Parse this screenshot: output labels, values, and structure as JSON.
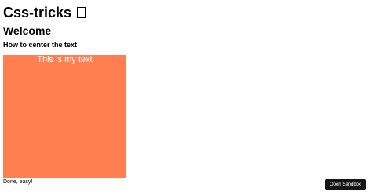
{
  "page": {
    "title": "Css-tricks",
    "subtitle": "Welcome",
    "heading": "How to center the text"
  },
  "demo": {
    "text": "This is my text",
    "box_color": "#ff7f50"
  },
  "footer": {
    "text": "Done, easy!"
  },
  "sandbox": {
    "button_label": "Open Sandbox"
  }
}
